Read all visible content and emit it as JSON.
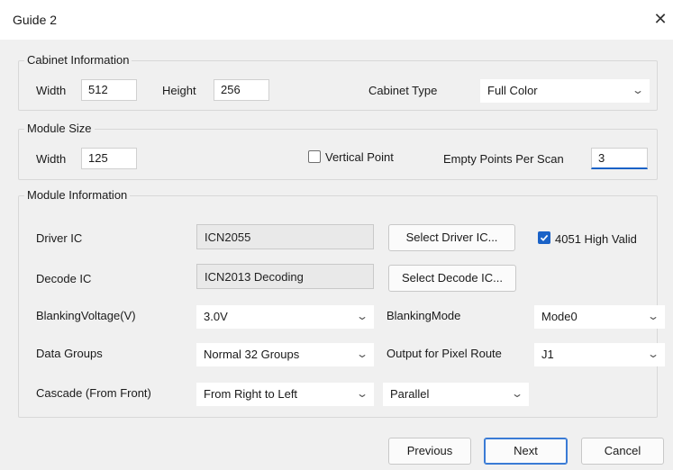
{
  "window": {
    "title": "Guide 2",
    "close_glyph": "✕"
  },
  "cabinet": {
    "legend": "Cabinet Information",
    "width_label": "Width",
    "width_value": "512",
    "height_label": "Height",
    "height_value": "256",
    "type_label": "Cabinet  Type",
    "type_value": "Full Color"
  },
  "module_size": {
    "legend": "Module Size",
    "width_label": "Width",
    "width_value": "125",
    "vertical_point_label": "Vertical Point",
    "vertical_point_checked": false,
    "empty_points_label": "Empty Points Per Scan",
    "empty_points_value": "3"
  },
  "module_info": {
    "legend": "Module Information",
    "driver_ic_label": "Driver IC",
    "driver_ic_value": "ICN2055",
    "select_driver_label": "Select Driver IC...",
    "high_valid_label": "4051 High Valid",
    "high_valid_checked": true,
    "decode_ic_label": "Decode IC",
    "decode_ic_value": "ICN2013 Decoding",
    "select_decode_label": "Select Decode IC...",
    "blanking_voltage_label": "BlankingVoltage(V)",
    "blanking_voltage_value": "3.0V",
    "blanking_mode_label": "BlankingMode",
    "blanking_mode_value": "Mode0",
    "data_groups_label": "Data Groups",
    "data_groups_value": "Normal 32 Groups",
    "output_route_label": "Output for Pixel Route",
    "output_route_value": "J1",
    "cascade_label": "Cascade (From Front)",
    "cascade_value": "From Right to Left",
    "parallel_value": "Parallel"
  },
  "footer": {
    "previous_label": "Previous",
    "next_label": "Next",
    "cancel_label": "Cancel"
  },
  "icons": {
    "chevron": "chevron-down-icon",
    "check": "checkmark-icon",
    "close": "close-icon"
  },
  "colors": {
    "accent": "#1a62c7",
    "window_bg": "#f0f0f0",
    "titlebar_bg": "#ffffff"
  }
}
